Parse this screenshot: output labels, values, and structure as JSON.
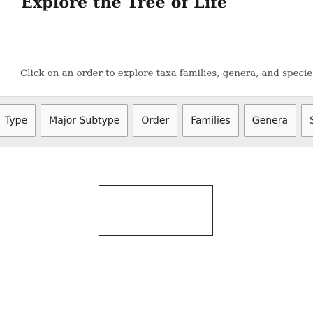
{
  "heading": "Explore the Tree of Life",
  "instruction": "Click on an order to explore taxa families, genera, and species",
  "nav": {
    "buttons": [
      {
        "label": "Type"
      },
      {
        "label": "Major Subtype"
      },
      {
        "label": "Order"
      },
      {
        "label": "Families"
      },
      {
        "label": "Genera"
      },
      {
        "label": "Species"
      }
    ]
  },
  "colors": {
    "nav_bar_background": "#ececec",
    "button_background": "#f9f9f9",
    "button_border": "#a6a6a6",
    "heading_text": "#1a1a1a",
    "instruction_text": "#4a4a4a"
  }
}
